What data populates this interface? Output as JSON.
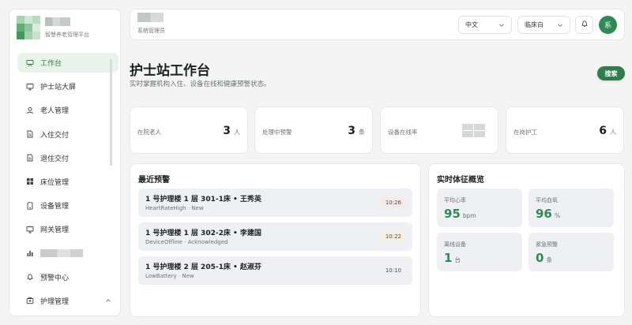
{
  "brand": {
    "subtitle": "智慧养老管理平台",
    "logo_colors": [
      "#a8d3b0",
      "#cfe6d3",
      "#b7dcbd",
      "#5fae74",
      "#8cc79a",
      "#d8ecdb",
      "#3f9a5c",
      "#a0cfa9",
      "#c6e2cb"
    ]
  },
  "sidebar": {
    "items": [
      {
        "label": "工作台",
        "icon": "workbench-icon",
        "active": true
      },
      {
        "label": "护士站大屏",
        "icon": "monitor-icon"
      },
      {
        "label": "老人管理",
        "icon": "user-icon"
      },
      {
        "label": "入住交付",
        "icon": "document-icon"
      },
      {
        "label": "退住交付",
        "icon": "document-icon"
      },
      {
        "label": "床位管理",
        "icon": "grid-icon"
      },
      {
        "label": "设备管理",
        "icon": "tablet-icon"
      },
      {
        "label": "网关管理",
        "icon": "monitor-icon"
      },
      {
        "label": "",
        "icon": "bar-chart-icon",
        "blurred": true
      },
      {
        "label": "预警中心",
        "icon": "bell-icon"
      },
      {
        "label": "护理管理",
        "icon": "care-icon",
        "expandable": true
      }
    ]
  },
  "header": {
    "user_role": "系统管理员",
    "language": "中文",
    "theme": "临床白",
    "avatar_initial": "系"
  },
  "page": {
    "title": "护士站工作台",
    "description": "实时掌握机构入住、设备在线和健康预警状态。",
    "search_label": "搜索"
  },
  "stats": [
    {
      "label": "在院老人",
      "value": "3",
      "unit": "人"
    },
    {
      "label": "处理中预警",
      "value": "3",
      "unit": "条"
    },
    {
      "label": "设备在线率",
      "value": "",
      "unit": ""
    },
    {
      "label": "在岗护工",
      "value": "6",
      "unit": "人"
    }
  ],
  "alerts": {
    "title": "最近预警",
    "items": [
      {
        "title": "1 号护理楼 1 层 301-1床 • 王秀英",
        "sub": "HeartRateHigh · New",
        "time": "10:26",
        "time_bg": "#f7e9e6"
      },
      {
        "title": "1 号护理楼 1 层 302-2床 • 李建国",
        "sub": "DeviceOffline · Acknowledged",
        "time": "10:22",
        "time_bg": "#f7efe0"
      },
      {
        "title": "1 号护理楼 2 层 205-1床 • 赵淑芬",
        "sub": "LowBattery · New",
        "time": "10:10",
        "time_bg": "#eef0f4"
      }
    ]
  },
  "vitals": {
    "title": "实时体征概览",
    "items": [
      {
        "label": "平均心率",
        "value": "95",
        "unit": "bpm"
      },
      {
        "label": "平均血氧",
        "value": "96",
        "unit": "%"
      },
      {
        "label": "离线设备",
        "value": "1",
        "unit": "台"
      },
      {
        "label": "紧急预警",
        "value": "0",
        "unit": "条"
      }
    ]
  },
  "colors": {
    "accent": "#2f7d4c",
    "accent_light": "#e8f3ea"
  }
}
